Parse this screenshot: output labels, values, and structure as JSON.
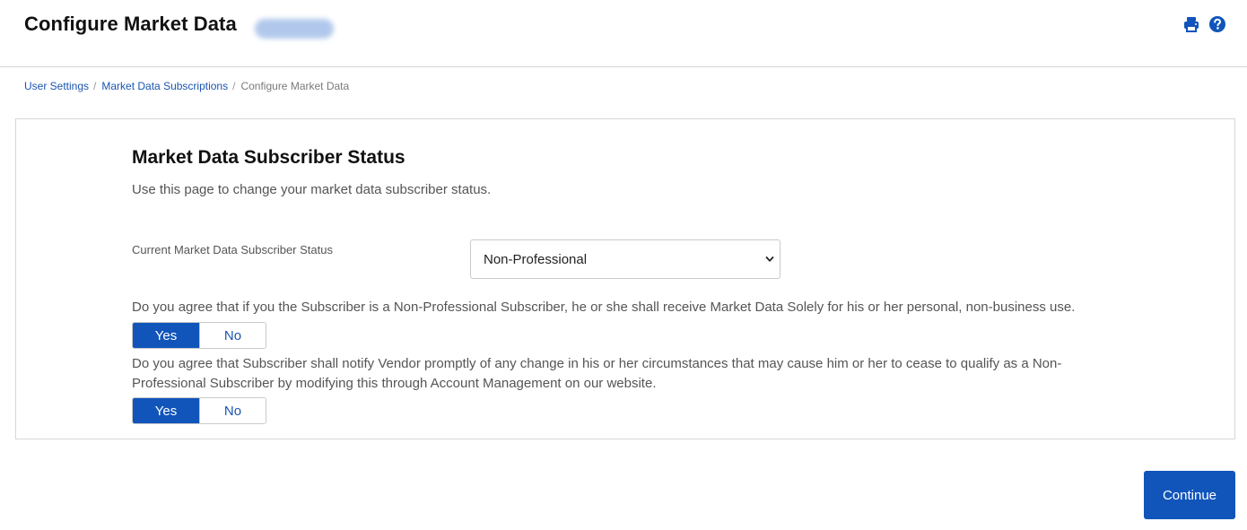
{
  "header": {
    "title": "Configure Market Data",
    "account_badge": "",
    "print_icon": "print-icon",
    "help_icon": "help-icon"
  },
  "breadcrumb": {
    "items": [
      "User Settings",
      "Market Data Subscriptions"
    ],
    "separator": "/",
    "current": "Configure Market Data"
  },
  "section": {
    "title": "Market Data Subscriber Status",
    "description": "Use this page to change your market data subscriber status."
  },
  "status": {
    "label": "Current Market Data Subscriber Status",
    "selected": "Non-Professional"
  },
  "questions": [
    {
      "text": "Do you agree that if you the Subscriber is a Non-Professional Subscriber, he or she shall receive Market Data Solely for his or her personal, non-business use.",
      "yes": "Yes",
      "no": "No",
      "selected": "Yes"
    },
    {
      "text": "Do you agree that Subscriber shall notify Vendor promptly of any change in his or her circumstances that may cause him or her to cease to qualify as a Non-Professional Subscriber by modifying this through Account Management on our website.",
      "yes": "Yes",
      "no": "No",
      "selected": "Yes"
    }
  ],
  "actions": {
    "continue_label": "Continue"
  },
  "colors": {
    "accent": "#1155bb",
    "link": "#1a55b0",
    "border": "#d6d6d6"
  }
}
